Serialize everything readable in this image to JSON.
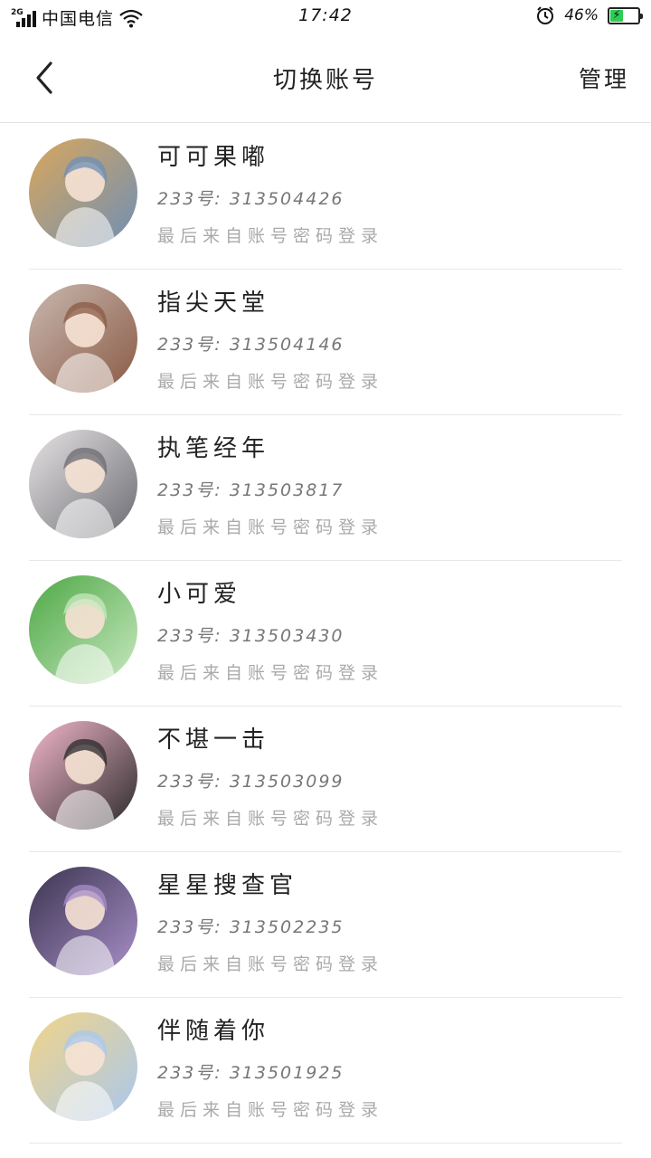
{
  "status": {
    "network": "2G",
    "carrier": "中国电信",
    "time": "17:42",
    "battery": "46%",
    "battery_level": 0.46
  },
  "header": {
    "back_icon": "back-arrow-icon",
    "title": "切换账号",
    "manage_label": "管理"
  },
  "accounts": [
    {
      "name": "可可果嘟",
      "uid": "233号: 313504426",
      "last_login": "最后来自账号密码登录",
      "avatar_colors": [
        "#d9a75c",
        "#6f8fb5"
      ]
    },
    {
      "name": "指尖天堂",
      "uid": "233号: 313504146",
      "last_login": "最后来自账号密码登录",
      "avatar_colors": [
        "#c9b8b0",
        "#8a5a44"
      ]
    },
    {
      "name": "执笔经年",
      "uid": "233号: 313503817",
      "last_login": "最后来自账号密码登录",
      "avatar_colors": [
        "#e6e3e3",
        "#6b6b72"
      ]
    },
    {
      "name": "小可爱",
      "uid": "233号: 313503430",
      "last_login": "最后来自账号密码登录",
      "avatar_colors": [
        "#4ea846",
        "#c8e8c0"
      ]
    },
    {
      "name": "不堪一击",
      "uid": "233号: 313503099",
      "last_login": "最后来自账号密码登录",
      "avatar_colors": [
        "#f4b8cc",
        "#2a2a2a"
      ]
    },
    {
      "name": "星星搜查官",
      "uid": "233号: 313502235",
      "last_login": "最后来自账号密码登录",
      "avatar_colors": [
        "#3b3550",
        "#a88fc8"
      ]
    },
    {
      "name": "伴随着你",
      "uid": "233号: 313501925",
      "last_login": "最后来自账号密码登录",
      "avatar_colors": [
        "#f2d488",
        "#a9c8ee"
      ]
    }
  ]
}
